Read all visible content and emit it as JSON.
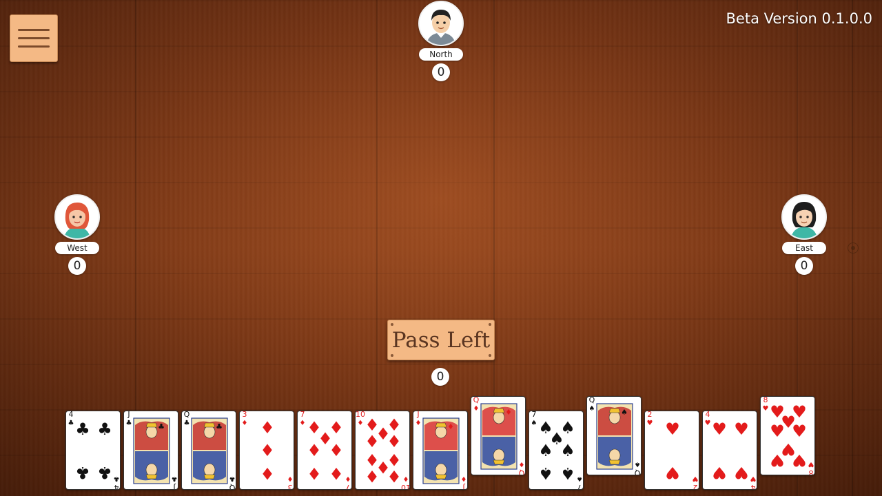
{
  "header": {
    "version": "Beta Version 0.1.0.0",
    "menu_icon": "hamburger-menu-icon"
  },
  "players": {
    "north": {
      "name": "North",
      "score": "0",
      "avatar": "man-avatar-icon"
    },
    "west": {
      "name": "West",
      "score": "0",
      "avatar": "red-haired-woman-avatar-icon"
    },
    "east": {
      "name": "East",
      "score": "0",
      "avatar": "dark-haired-woman-avatar-icon"
    }
  },
  "action": {
    "pass_label": "Pass Left"
  },
  "me": {
    "score": "0"
  },
  "colors": {
    "red": "#e31b1b",
    "black": "#111111",
    "button": "#f4b985",
    "button_text": "#5a3521"
  },
  "hand": [
    {
      "rank": "4",
      "suit": "clubs",
      "face": false,
      "raised": false
    },
    {
      "rank": "J",
      "suit": "clubs",
      "face": true,
      "raised": false
    },
    {
      "rank": "Q",
      "suit": "clubs",
      "face": true,
      "raised": false
    },
    {
      "rank": "3",
      "suit": "diamonds",
      "face": false,
      "raised": false
    },
    {
      "rank": "7",
      "suit": "diamonds",
      "face": false,
      "raised": false
    },
    {
      "rank": "10",
      "suit": "diamonds",
      "face": false,
      "raised": false
    },
    {
      "rank": "J",
      "suit": "diamonds",
      "face": true,
      "raised": false
    },
    {
      "rank": "Q",
      "suit": "diamonds",
      "face": true,
      "raised": true
    },
    {
      "rank": "7",
      "suit": "spades",
      "face": false,
      "raised": false
    },
    {
      "rank": "Q",
      "suit": "spades",
      "face": true,
      "raised": true
    },
    {
      "rank": "2",
      "suit": "hearts",
      "face": false,
      "raised": false
    },
    {
      "rank": "4",
      "suit": "hearts",
      "face": false,
      "raised": false
    },
    {
      "rank": "8",
      "suit": "hearts",
      "face": false,
      "raised": true
    }
  ]
}
